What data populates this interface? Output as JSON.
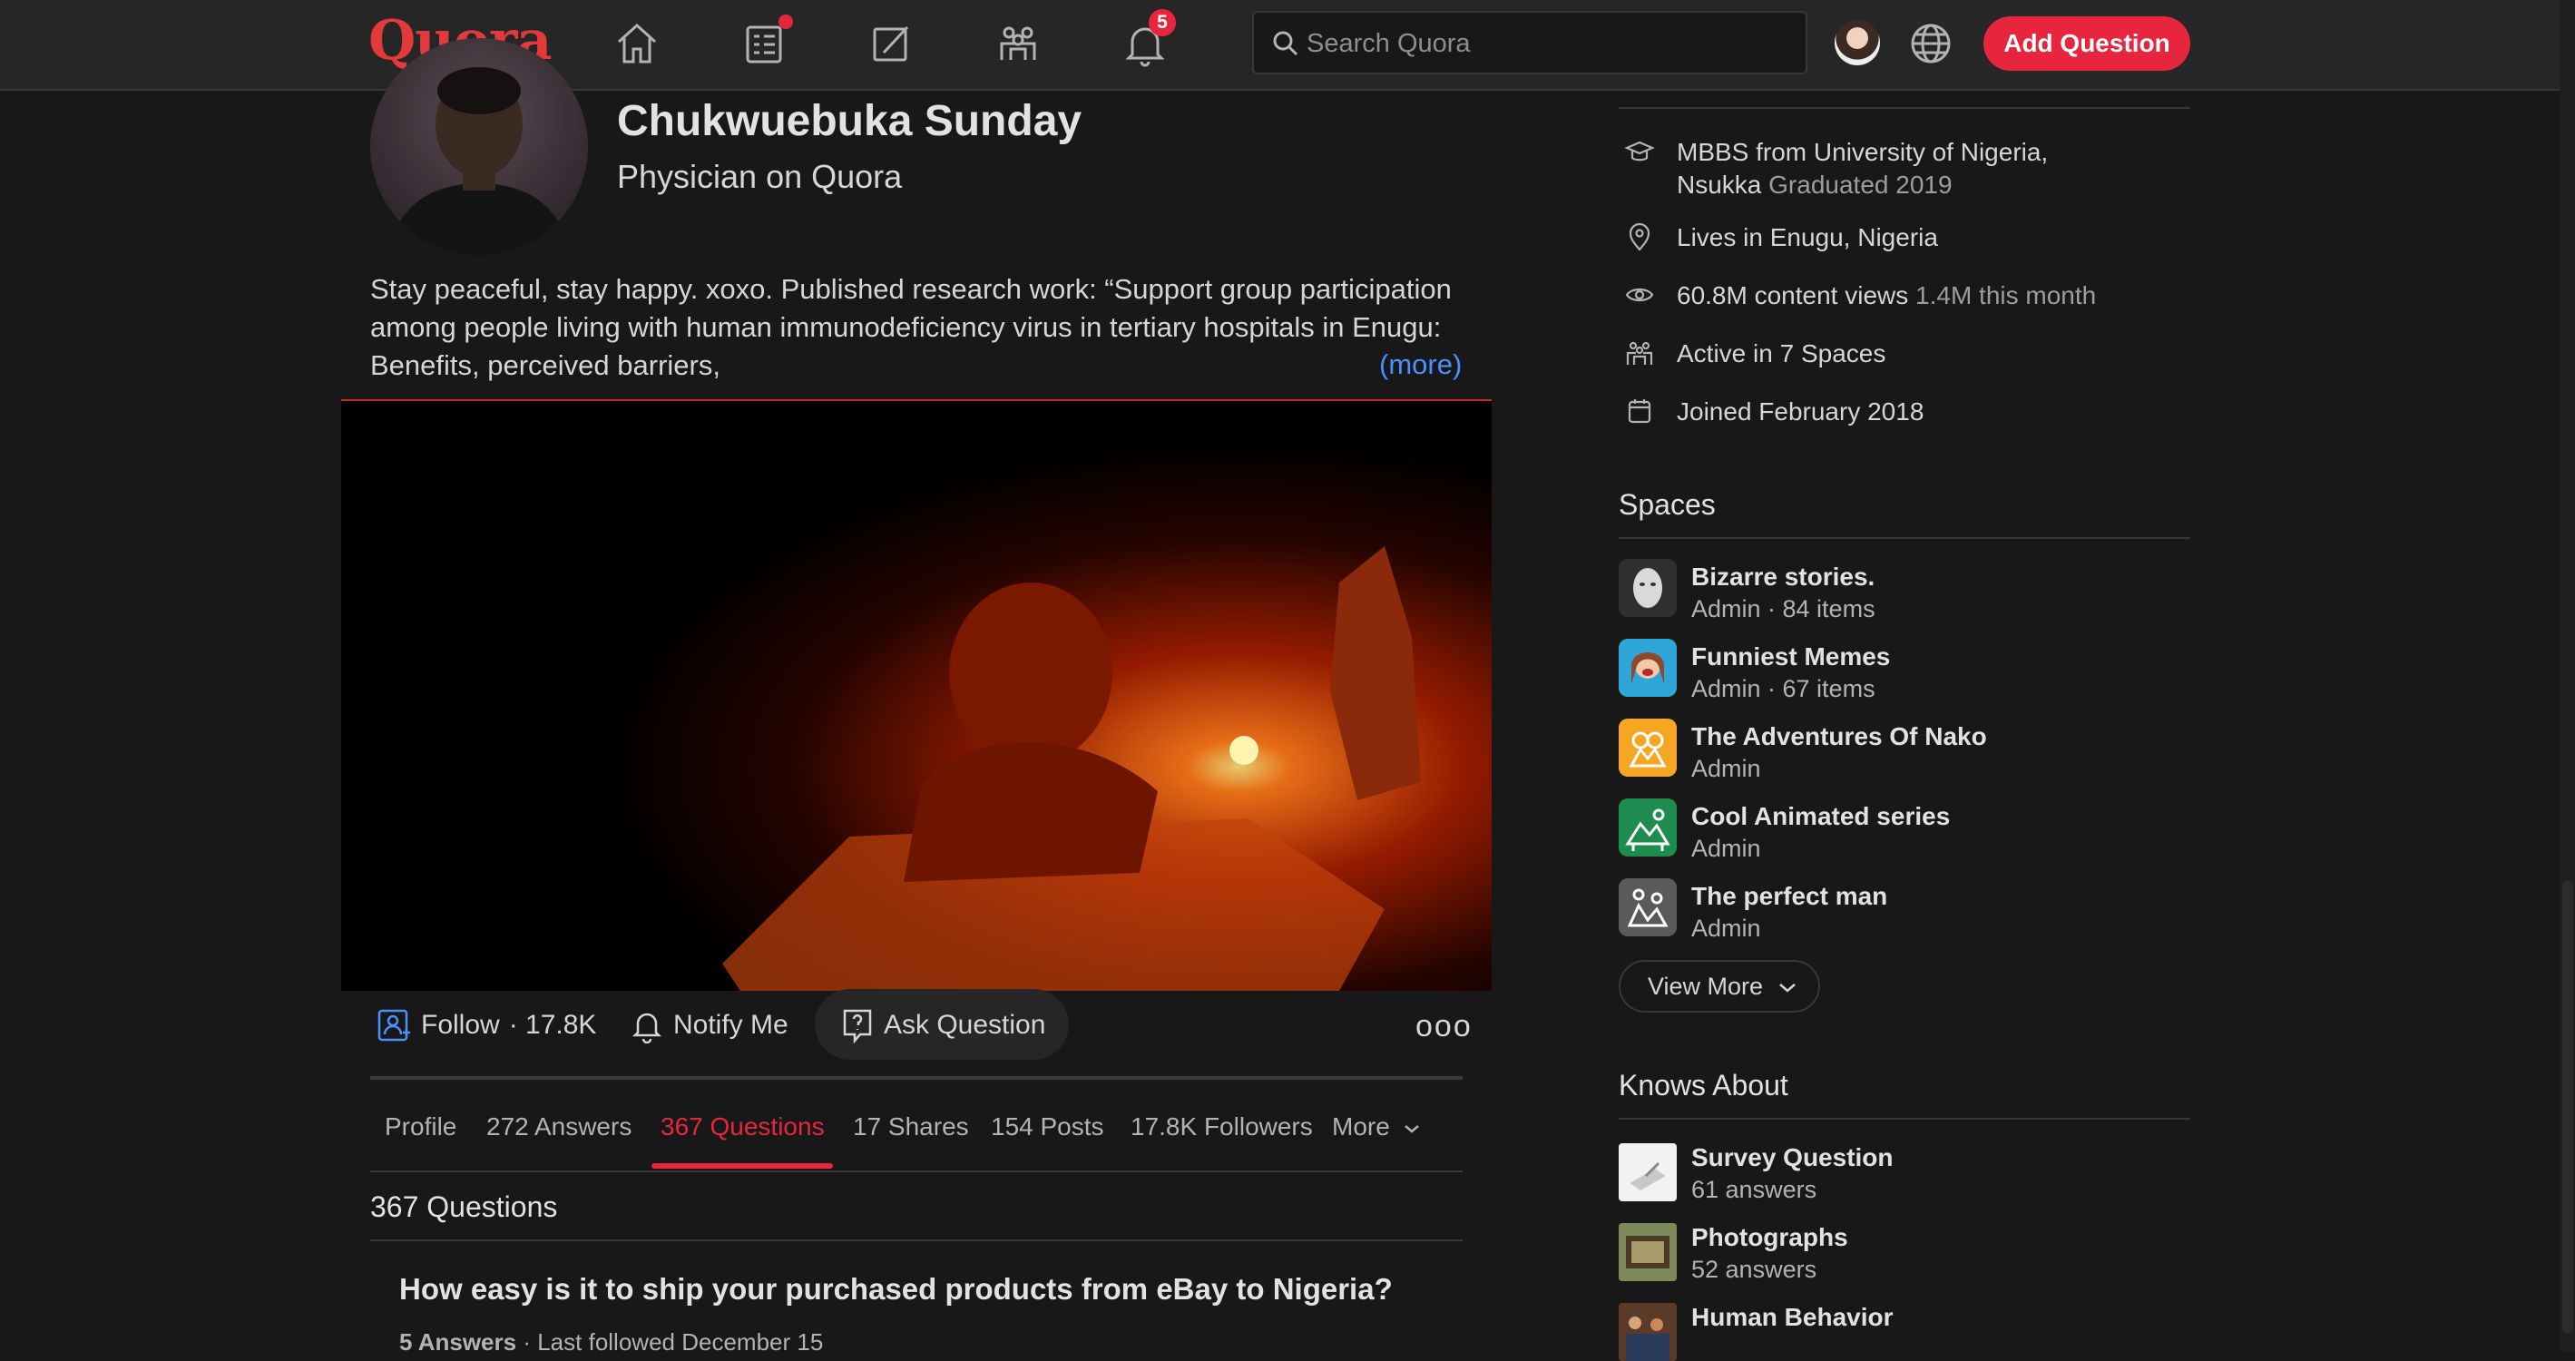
{
  "header": {
    "logo": "Quora",
    "search_placeholder": "Search Quora",
    "notifications_count": "5",
    "add_question_label": "Add Question"
  },
  "profile": {
    "name": "Chukwuebuka Sunday",
    "credential": "Physician on Quora",
    "bio": "Stay peaceful, stay happy. xoxo. Published research work: “Support group participation among people living with human immunodeficiency virus in tertiary hospitals in Enugu: Benefits, perceived barriers,",
    "more_link": "(more)"
  },
  "actions": {
    "follow_label": "Follow",
    "follow_count": "· 17.8K",
    "notify_label": "Notify Me",
    "ask_label": "Ask Question",
    "more_dots": "ooo"
  },
  "tabs": [
    {
      "label": "Profile",
      "active": false
    },
    {
      "label": "272 Answers",
      "active": false
    },
    {
      "label": "367 Questions",
      "active": true
    },
    {
      "label": "17 Shares",
      "active": false
    },
    {
      "label": "154 Posts",
      "active": false
    },
    {
      "label": "17.8K Followers",
      "active": false
    },
    {
      "label": "More",
      "active": false
    }
  ],
  "content": {
    "section_title": "367 Questions",
    "questions": [
      {
        "title": "How easy is it to ship your purchased products from eBay to Nigeria?",
        "answers": "5 Answers",
        "meta": "· Last followed December 15"
      }
    ]
  },
  "credentials": {
    "education_line1": "MBBS from University of Nigeria,",
    "education_line2": "Nsukka",
    "education_extra": "Graduated 2019",
    "location": "Lives in Enugu, Nigeria",
    "views": "60.8M content views",
    "views_extra": "1.4M this month",
    "spaces": "Active in 7 Spaces",
    "joined": "Joined February 2018"
  },
  "spaces": {
    "heading": "Spaces",
    "items": [
      {
        "name": "Bizarre stories.",
        "sub": "Admin · 84 items",
        "icon": "mask-face-icon",
        "color": "#2f2f2f"
      },
      {
        "name": "Funniest Memes",
        "sub": "Admin · 67 items",
        "icon": "laughing-woman-icon",
        "color": "#2ea6d8"
      },
      {
        "name": "The Adventures Of Nako",
        "sub": "Admin",
        "icon": "adventure-icon",
        "color": "#f5a623"
      },
      {
        "name": "Cool Animated series",
        "sub": "Admin",
        "icon": "animated-scene-icon",
        "color": "#1e8c4e"
      },
      {
        "name": "The perfect man",
        "sub": "Admin",
        "icon": "people-scene-icon",
        "color": "#5a5a5a"
      }
    ],
    "view_more": "View More"
  },
  "knows_about": {
    "heading": "Knows About",
    "items": [
      {
        "name": "Survey Question",
        "sub": "61 answers",
        "icon": "survey-thumbnail"
      },
      {
        "name": "Photographs",
        "sub": "52 answers",
        "icon": "photographs-thumbnail"
      },
      {
        "name": "Human Behavior",
        "sub": "",
        "icon": "human-behavior-thumbnail"
      }
    ]
  },
  "colors": {
    "brand": "#e23a3a",
    "accent": "#e7263e",
    "link": "#4a90ff",
    "background": "#181818",
    "header_bg": "#262626"
  }
}
